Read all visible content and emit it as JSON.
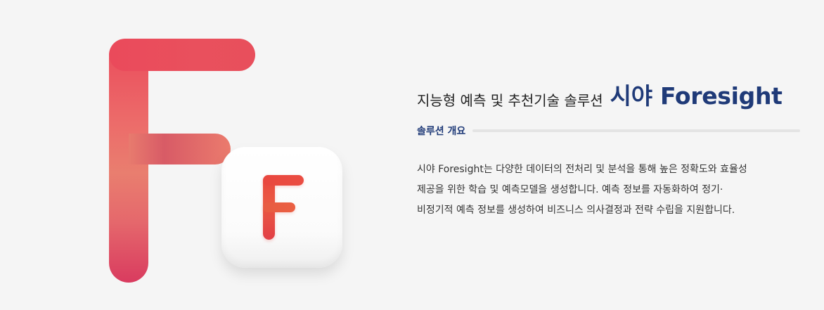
{
  "header": {
    "prefix": "지능형 예측 및 추천기술 솔루션",
    "brand": "시야 Foresight"
  },
  "section": {
    "label": "솔루션 개요"
  },
  "description": {
    "lines": [
      "시야 Foresight는 다양한 데이터의 전처리 및 분석을 통해 높은 정확도와 효율성",
      "제공을 위한 학습 및 예측모델을 생성합니다. 예측 정보를 자동화하여 정기·",
      "비정기적 예측 정보를 생성하여 비즈니스 의사결정과 전략 수립을 지원합니다."
    ]
  },
  "art": {
    "big_letter_icon": "foresight-logo-icon",
    "app_tile_icon": "foresight-app-icon",
    "app_tile_letter_icon": "letter-f-icon"
  },
  "colors": {
    "accent": "#1f3a78",
    "brand_red": "#e9473f",
    "brand_pink": "#ea4a5b",
    "brand_coral": "#e97e6f"
  }
}
